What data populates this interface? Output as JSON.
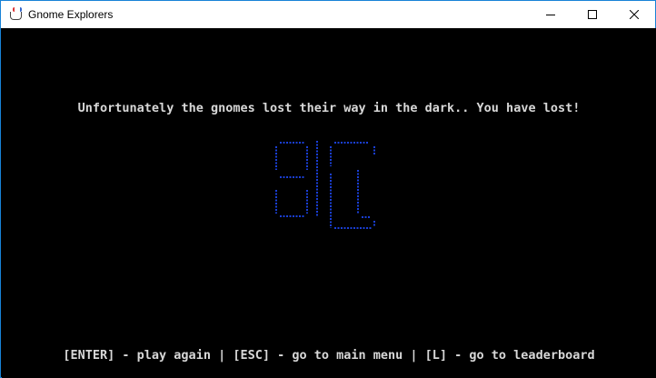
{
  "window": {
    "title": "Gnome Explorers",
    "controls": {
      "minimize": "minimize-icon",
      "maximize": "maximize-icon",
      "close": "close-icon"
    }
  },
  "game": {
    "message": "Unfortunately the gnomes lost their way in the dark.. You have lost!",
    "emoticon_color": "#1a3fd6",
    "footer": "[ENTER] - play again | [ESC] - go to main menu | [L] - go to leaderboard"
  },
  "colors": {
    "background": "#000000",
    "text": "#d8d8d8",
    "accent_border": "#1883d7"
  }
}
